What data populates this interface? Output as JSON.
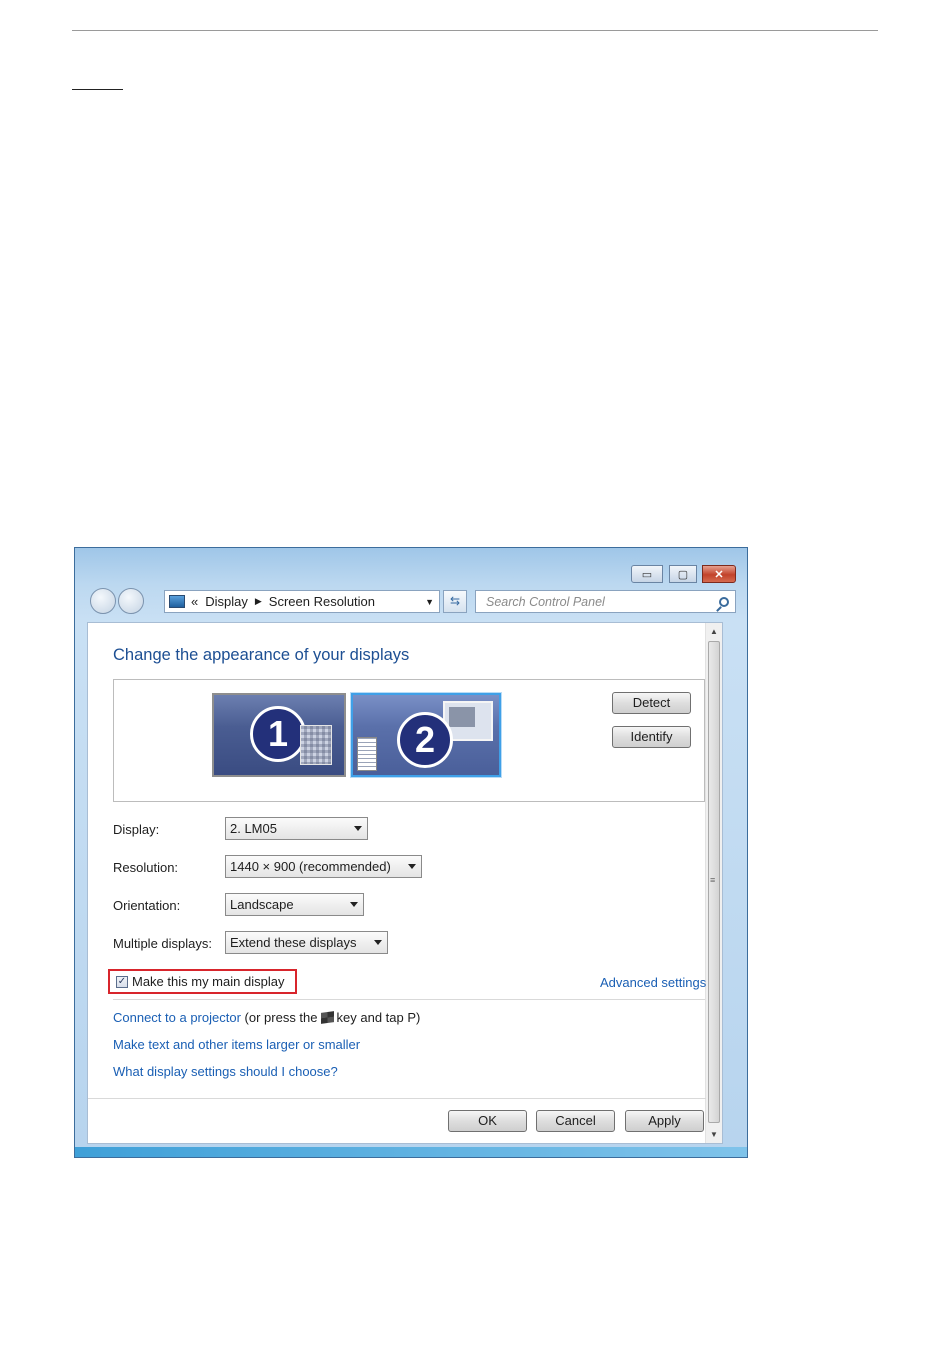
{
  "window": {
    "controls": {
      "minimize": "▭",
      "maximize": "▢",
      "close": "✕"
    },
    "address": {
      "chevron": "«",
      "crumb1": "Display",
      "crumb2": "Screen Resolution"
    },
    "search": {
      "placeholder": "Search Control Panel"
    }
  },
  "main": {
    "title": "Change the appearance of your displays",
    "monitors": [
      {
        "number": "1"
      },
      {
        "number": "2"
      }
    ],
    "detect_label": "Detect",
    "identify_label": "Identify",
    "fields": {
      "display": {
        "label": "Display:",
        "value": "2. LM05"
      },
      "resolution": {
        "label": "Resolution:",
        "value": "1440 × 900 (recommended)"
      },
      "orientation": {
        "label": "Orientation:",
        "value": "Landscape"
      },
      "multiple": {
        "label": "Multiple displays:",
        "value": "Extend these displays"
      }
    },
    "main_display_checkbox": {
      "label": "Make this my main display",
      "checked": true
    },
    "advanced_settings": "Advanced settings",
    "links": {
      "projector": "Connect to a projector",
      "projector_suffix_1": "(or press the",
      "projector_suffix_2": "key and tap P)",
      "text_size": "Make text and other items larger or smaller",
      "help": "What display settings should I choose?"
    },
    "buttons": {
      "ok": "OK",
      "cancel": "Cancel",
      "apply": "Apply"
    }
  }
}
